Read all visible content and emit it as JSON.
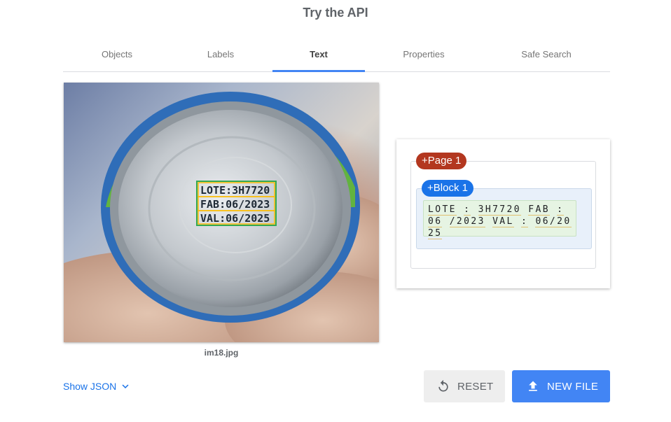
{
  "page": {
    "title": "Try the API"
  },
  "tabs": [
    {
      "label": "Objects",
      "active": false
    },
    {
      "label": "Labels",
      "active": false
    },
    {
      "label": "Text",
      "active": true
    },
    {
      "label": "Properties",
      "active": false
    },
    {
      "label": "Safe Search",
      "active": false
    }
  ],
  "image": {
    "filename": "im18.jpg",
    "detected_lines": [
      "LOTE:3H7720",
      "FAB:06/2023",
      "VAL:06/2025"
    ]
  },
  "result": {
    "page_label": "+Page 1",
    "block_label": "+Block 1",
    "words": [
      "LOTE",
      ":",
      "3H7720",
      "FAB",
      ":",
      "06",
      "/2023",
      "VAL",
      ":",
      "06/2025"
    ]
  },
  "footer": {
    "show_json": "Show JSON",
    "reset_label": "RESET",
    "new_file_label": "NEW FILE"
  },
  "colors": {
    "accent": "#4285f4",
    "page_badge": "#b3371f",
    "block_badge": "#1a73e8"
  },
  "icons": {
    "chevron": "chevron-down-icon",
    "reset": "refresh-icon",
    "upload": "upload-icon"
  }
}
